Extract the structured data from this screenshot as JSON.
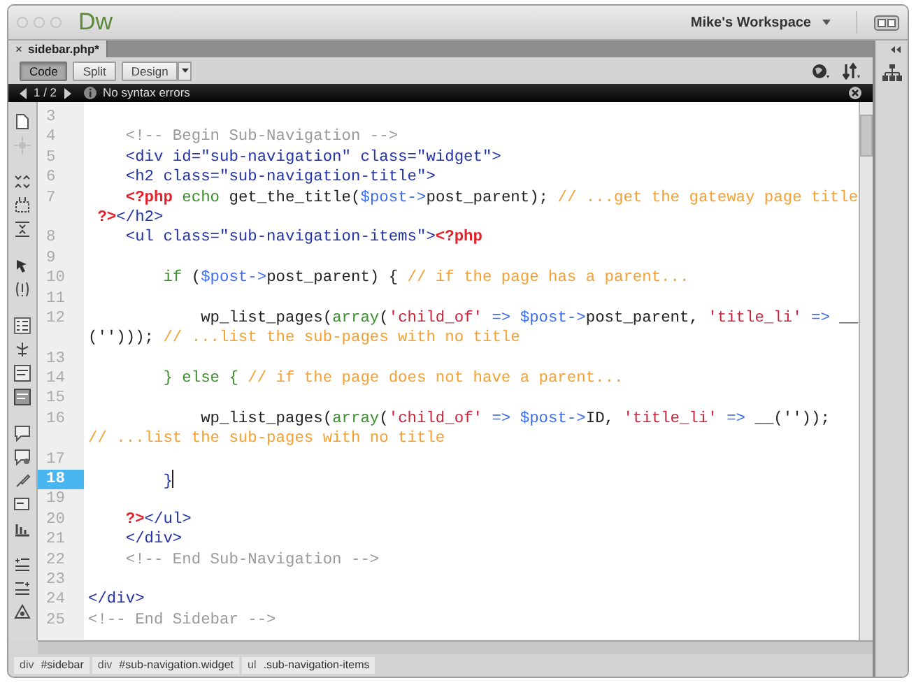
{
  "window": {
    "logo": "Dw",
    "workspace": "Mike's Workspace"
  },
  "document_tab": {
    "close": "×",
    "title": "sidebar.php*"
  },
  "view_buttons": [
    {
      "label": "Code",
      "selected": true
    },
    {
      "label": "Split",
      "selected": false
    },
    {
      "label": "Design",
      "selected": false
    }
  ],
  "info_bar": {
    "page": "1 / 2",
    "message": "No syntax errors"
  },
  "code_lines": [
    {
      "number": "3",
      "selected": false
    },
    {
      "number": "4",
      "selected": false,
      "rows": [
        {
          "tokens": [
            {
              "kind": "comment",
              "text": "    <!-- Begin Sub-Navigation -->"
            }
          ]
        }
      ]
    },
    {
      "number": "5",
      "selected": false,
      "rows": [
        {
          "tokens": [
            {
              "kind": "tag",
              "text": "    <div id=\"sub-navigation\" class=\"widget\">"
            }
          ]
        }
      ]
    },
    {
      "number": "6",
      "selected": false,
      "rows": [
        {
          "tokens": [
            {
              "kind": "tag",
              "text": "    <h2 class=\"sub-navigation-title\">"
            }
          ]
        }
      ]
    },
    {
      "number": "7",
      "selected": false,
      "rows": [
        {
          "tokens": [
            {
              "kind": "php",
              "text": "    <?php"
            },
            {
              "kind": "keyword",
              "text": " echo"
            },
            {
              "kind": "func",
              "text": " get_the_title("
            },
            {
              "kind": "var",
              "text": "$post->"
            },
            {
              "kind": "func",
              "text": "post_parent); "
            },
            {
              "kind": "phpcomment",
              "text": "// ...get the gateway page title"
            }
          ]
        },
        {
          "tokens": [
            {
              "kind": "php",
              "text": " ?>"
            },
            {
              "kind": "tag",
              "text": "</h2>"
            }
          ]
        }
      ]
    },
    {
      "number": "8",
      "selected": false,
      "rows": [
        {
          "tokens": [
            {
              "kind": "tag",
              "text": "    <ul class=\"sub-navigation-items\">"
            },
            {
              "kind": "php",
              "text": "<?php"
            }
          ]
        }
      ]
    },
    {
      "number": "9",
      "selected": false
    },
    {
      "number": "10",
      "selected": false,
      "rows": [
        {
          "tokens": [
            {
              "kind": "keyword",
              "text": "        if"
            },
            {
              "kind": "func",
              "text": " ("
            },
            {
              "kind": "var",
              "text": "$post->"
            },
            {
              "kind": "func",
              "text": "post_parent) {"
            },
            {
              "kind": "phpcomment",
              "text": " // if the page has a parent..."
            }
          ]
        }
      ]
    },
    {
      "number": "11",
      "selected": false
    },
    {
      "number": "12",
      "selected": false,
      "rows": [
        {
          "tokens": [
            {
              "kind": "func",
              "text": "            wp_list_pages("
            },
            {
              "kind": "keyword",
              "text": "array"
            },
            {
              "kind": "func",
              "text": "("
            },
            {
              "kind": "string",
              "text": "'child_of'"
            },
            {
              "kind": "var",
              "text": " => $post->"
            },
            {
              "kind": "func",
              "text": "post_parent, "
            },
            {
              "kind": "string",
              "text": "'title_li'"
            },
            {
              "kind": "var",
              "text": " =>"
            },
            {
              "kind": "func",
              "text": " __"
            }
          ]
        },
        {
          "tokens": [
            {
              "kind": "func",
              "text": "(''))); "
            },
            {
              "kind": "phpcomment",
              "text": "// ...list the sub-pages with no title"
            }
          ]
        }
      ]
    },
    {
      "number": "13",
      "selected": false
    },
    {
      "number": "14",
      "selected": false,
      "rows": [
        {
          "tokens": [
            {
              "kind": "keyword",
              "text": "        } else {"
            },
            {
              "kind": "phpcomment",
              "text": " // if the page does not have a parent..."
            }
          ]
        }
      ]
    },
    {
      "number": "15",
      "selected": false
    },
    {
      "number": "16",
      "selected": false,
      "rows": [
        {
          "tokens": [
            {
              "kind": "func",
              "text": "            wp_list_pages("
            },
            {
              "kind": "keyword",
              "text": "array"
            },
            {
              "kind": "func",
              "text": "("
            },
            {
              "kind": "string",
              "text": "'child_of'"
            },
            {
              "kind": "var",
              "text": " => $post->"
            },
            {
              "kind": "func",
              "text": "ID, "
            },
            {
              "kind": "string",
              "text": "'title_li'"
            },
            {
              "kind": "var",
              "text": " =>"
            },
            {
              "kind": "func",
              "text": " __(''));"
            }
          ]
        },
        {
          "tokens": [
            {
              "kind": "phpcomment",
              "text": "// ...list the sub-pages with no title"
            }
          ]
        }
      ]
    },
    {
      "number": "17",
      "selected": false
    },
    {
      "number": "18",
      "selected": true,
      "rows": [
        {
          "tokens": [
            {
              "kind": "tag",
              "text": "        }"
            }
          ]
        }
      ]
    },
    {
      "number": "19",
      "selected": false
    },
    {
      "number": "20",
      "selected": false,
      "rows": [
        {
          "tokens": [
            {
              "kind": "php",
              "text": "    ?>"
            },
            {
              "kind": "tag",
              "text": "</ul>"
            }
          ]
        }
      ]
    },
    {
      "number": "21",
      "selected": false,
      "rows": [
        {
          "tokens": [
            {
              "kind": "tag",
              "text": "    </div>"
            }
          ]
        }
      ]
    },
    {
      "number": "22",
      "selected": false,
      "rows": [
        {
          "tokens": [
            {
              "kind": "comment",
              "text": "    <!-- End Sub-Navigation -->"
            }
          ]
        }
      ]
    },
    {
      "number": "23",
      "selected": false
    },
    {
      "number": "24",
      "selected": false,
      "rows": [
        {
          "tokens": [
            {
              "kind": "tag",
              "text": "</div>"
            }
          ]
        }
      ]
    },
    {
      "number": "25",
      "selected": false,
      "rows": [
        {
          "tokens": [
            {
              "kind": "comment",
              "text": "<!-- End Sidebar -->"
            }
          ]
        }
      ]
    }
  ],
  "tag_selector": [
    {
      "tag": "div",
      "label": "#sidebar"
    },
    {
      "tag": "div",
      "label": "#sub-navigation.widget"
    },
    {
      "tag": "ul",
      "label": ".sub-navigation-items"
    }
  ]
}
